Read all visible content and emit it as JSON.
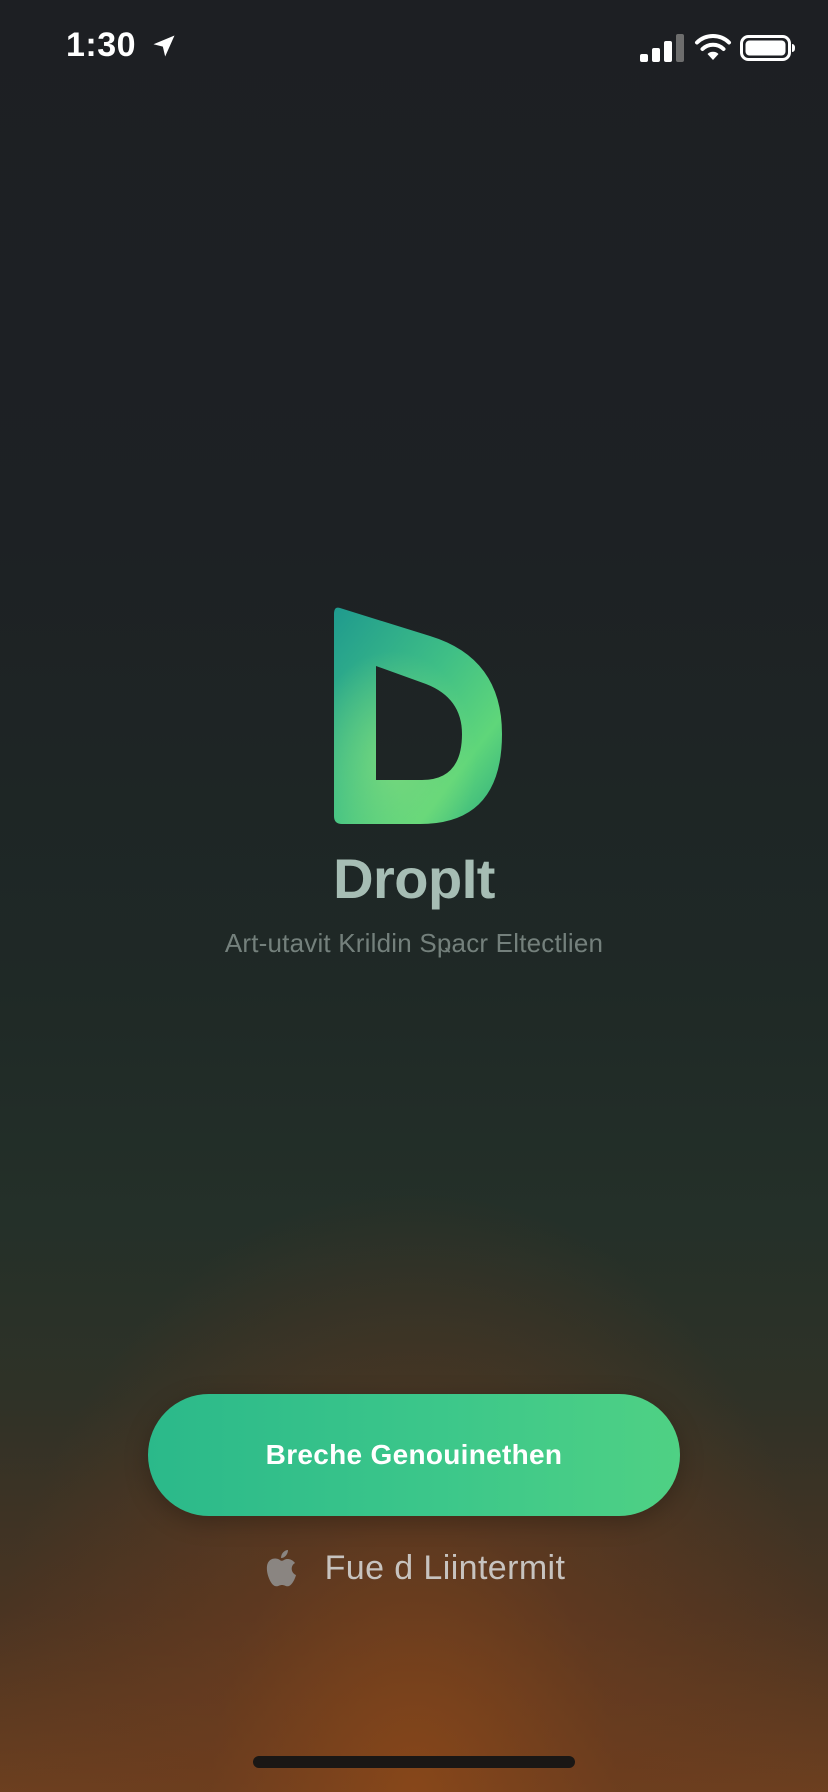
{
  "status_bar": {
    "time": "1:30",
    "location_icon": "location-arrow-icon",
    "signal_icon": "cellular-signal-icon",
    "wifi_icon": "wifi-icon",
    "battery_icon": "battery-icon"
  },
  "splash": {
    "logo_icon": "dropit-logo-icon",
    "app_name": "DropIt",
    "tagline": "Art-utavit Krildin Sҏacr Eltectlien"
  },
  "actions": {
    "primary_label": "Breche Genouinethen",
    "secondary_icon": "apple-icon",
    "secondary_label": "Fue d  Liintermit"
  },
  "colors": {
    "accent_green": "#3cc78a",
    "background_top": "#1d1f23",
    "background_bottom": "#6c3f1f"
  }
}
